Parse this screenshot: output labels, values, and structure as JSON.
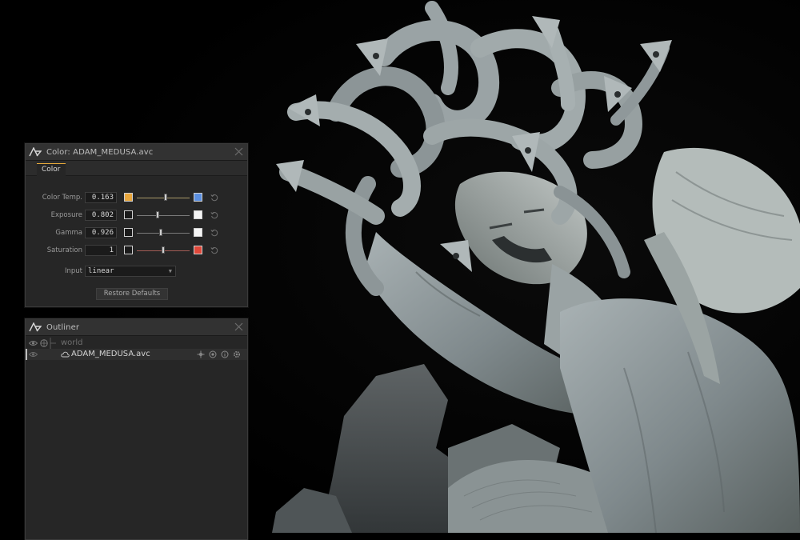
{
  "color_panel": {
    "title": "Color: ADAM_MEDUSA.avc",
    "tab_label": "Color",
    "params": [
      {
        "label": "Color Temp.",
        "value": "0.163",
        "left_swatch": "#e8a63c",
        "right_swatch": "#5b8fe0",
        "track_color": "#a89a6a",
        "handle_fraction": 0.55
      },
      {
        "label": "Exposure",
        "value": "0.802",
        "left_swatch": "#1b1b1b",
        "right_swatch": "#f5f5f5",
        "track_color": "#7a7a7a",
        "handle_fraction": 0.4
      },
      {
        "label": "Gamma",
        "value": "0.926",
        "left_swatch": "#1b1b1b",
        "right_swatch": "#f5f5f5",
        "track_color": "#7a7a7a",
        "handle_fraction": 0.46
      },
      {
        "label": "Saturation",
        "value": "1",
        "left_swatch": "#1b1b1b",
        "right_swatch": "#e0483a",
        "track_color": "#a25c55",
        "handle_fraction": 0.5
      }
    ],
    "input_label": "Input",
    "input_value": "linear",
    "restore_label": "Restore Defaults"
  },
  "outliner_panel": {
    "title": "Outliner",
    "tree": [
      {
        "label": "world",
        "depth": 0
      },
      {
        "label": "ADAM_MEDUSA.avc",
        "depth": 1,
        "selected": true
      }
    ]
  },
  "colors": {
    "accent": "#e6a93a",
    "panel_bg": "#262626",
    "sculpture": "#8c969a"
  },
  "icons": [
    "app-logo-icon",
    "close-icon",
    "reset-icon",
    "eye-icon",
    "globe-icon",
    "cloud-icon",
    "move-icon",
    "eye-dot-icon",
    "info-icon",
    "gear-icon"
  ]
}
